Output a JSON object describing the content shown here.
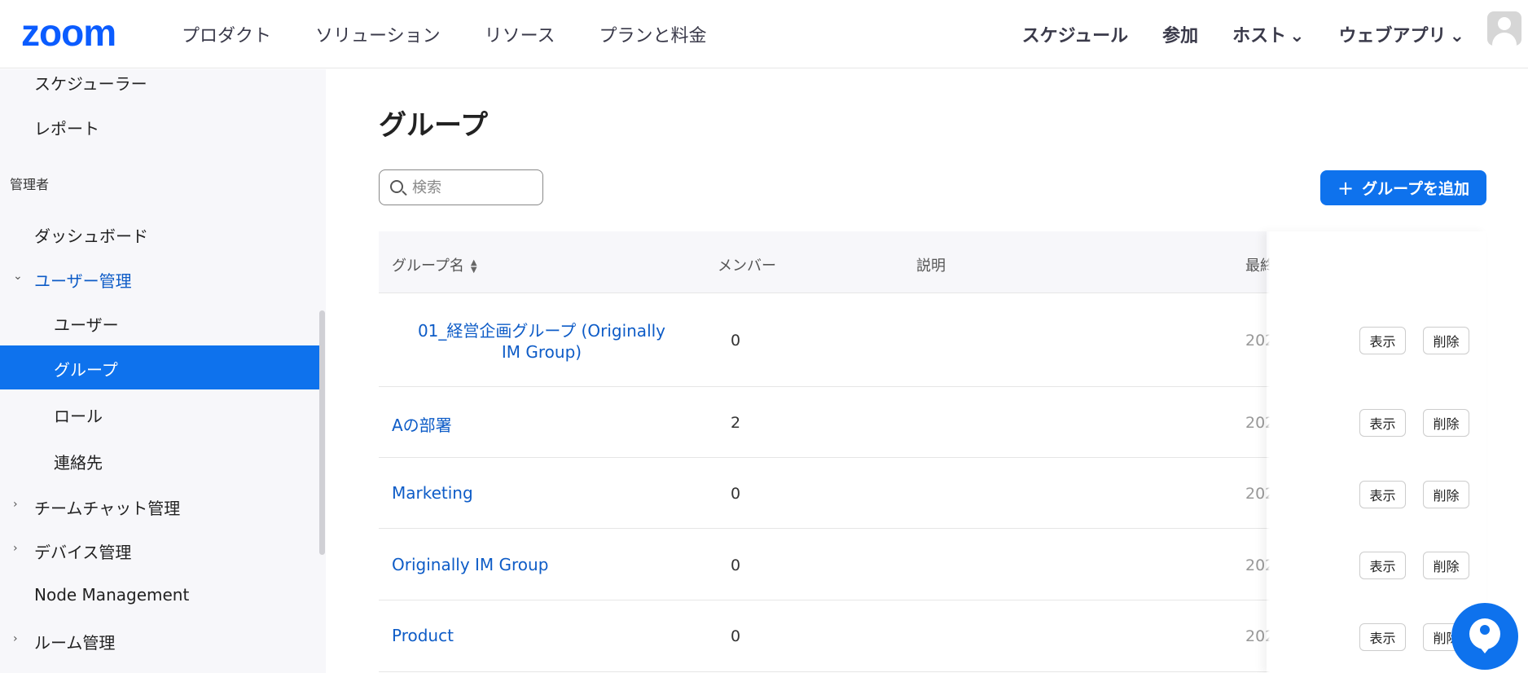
{
  "header": {
    "logo": "zoom",
    "nav_left": [
      "プロダクト",
      "ソリューション",
      "リソース",
      "プランと料金"
    ],
    "nav_right": {
      "schedule": "スケジュール",
      "join": "参加",
      "host": "ホスト",
      "webapp": "ウェブアプリ"
    }
  },
  "sidebar": {
    "scheduler": "スケジューラー",
    "reports": "レポート",
    "admin_section": "管理者",
    "dashboard": "ダッシュボード",
    "user_management": "ユーザー管理",
    "users": "ユーザー",
    "groups": "グループ",
    "roles": "ロール",
    "contacts": "連絡先",
    "team_chat": "チームチャット管理",
    "device_management": "デバイス管理",
    "node_management": "Node Management",
    "room_management": "ルーム管理"
  },
  "main": {
    "title": "グループ",
    "search_placeholder": "検索",
    "add_group": "グループを追加",
    "columns": {
      "name": "グループ名",
      "members": "メンバー",
      "description": "説明",
      "last_modified": "最終"
    },
    "rows": [
      {
        "name": "01_経営企画グループ (Originally IM Group)",
        "members": "0",
        "date": "202",
        "view": "表示",
        "delete": "削除"
      },
      {
        "name": "Aの部署",
        "members": "2",
        "date": "202",
        "view": "表示",
        "delete": "削除"
      },
      {
        "name": "Marketing",
        "members": "0",
        "date": "202",
        "view": "表示",
        "delete": "削除"
      },
      {
        "name": "Originally IM Group",
        "members": "0",
        "date": "202",
        "view": "表示",
        "delete": "削除"
      },
      {
        "name": "Product",
        "members": "0",
        "date": "202",
        "view": "表示",
        "delete": "削除"
      }
    ]
  },
  "colors": {
    "brand": "#0b5cff",
    "accent": "#0e72ed",
    "link": "#0e5cc7"
  }
}
